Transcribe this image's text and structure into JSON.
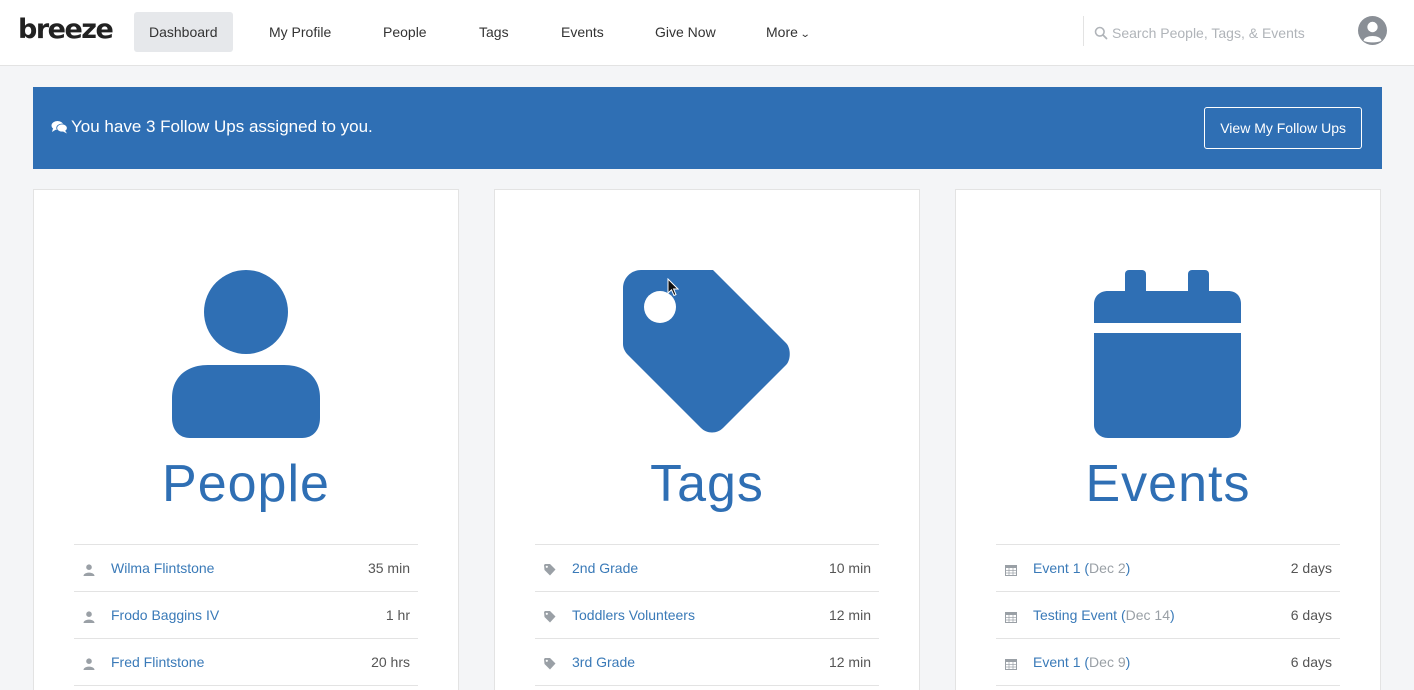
{
  "app": {
    "logo": "breeze"
  },
  "nav": {
    "items": [
      {
        "label": "Dashboard"
      },
      {
        "label": "My Profile"
      },
      {
        "label": "People"
      },
      {
        "label": "Tags"
      },
      {
        "label": "Events"
      },
      {
        "label": "Give Now"
      },
      {
        "label": "More"
      }
    ],
    "search_placeholder": "Search People, Tags, & Events"
  },
  "banner": {
    "message": "You have 3 Follow Ups assigned to you.",
    "button_label": "View My Follow Ups"
  },
  "colors": {
    "brand_blue": "#2f6fb4",
    "link_blue": "#3a7ab8"
  },
  "cards": {
    "people": {
      "title": "People",
      "rows": [
        {
          "name": "Wilma Flintstone",
          "time": "35 min"
        },
        {
          "name": "Frodo Baggins IV",
          "time": "1 hr"
        },
        {
          "name": "Fred Flintstone",
          "time": "20 hrs"
        }
      ]
    },
    "tags": {
      "title": "Tags",
      "rows": [
        {
          "name": "2nd Grade",
          "time": "10 min"
        },
        {
          "name": "Toddlers Volunteers",
          "time": "12 min"
        },
        {
          "name": "3rd Grade",
          "time": "12 min"
        }
      ]
    },
    "events": {
      "title": "Events",
      "rows": [
        {
          "name": "Event 1",
          "date": "Dec 2",
          "time": "2 days"
        },
        {
          "name": "Testing Event",
          "date": "Dec 14",
          "time": "6 days"
        },
        {
          "name": "Event 1",
          "date": "Dec 9",
          "time": "6 days"
        }
      ]
    }
  }
}
